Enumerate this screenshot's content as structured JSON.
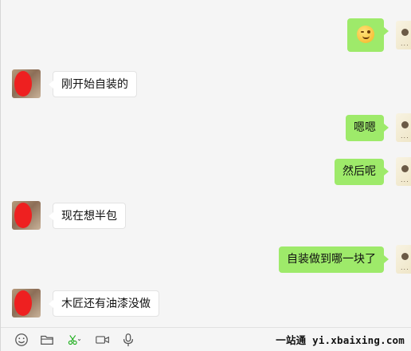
{
  "messages": [
    {
      "side": "right",
      "type": "emoji",
      "emoji": "wink-emoji"
    },
    {
      "side": "left",
      "text": "刚开始自装的"
    },
    {
      "side": "right",
      "text": "嗯嗯"
    },
    {
      "side": "right",
      "text": "然后呢"
    },
    {
      "side": "left",
      "text": "现在想半包"
    },
    {
      "side": "right",
      "text": "自装做到哪一块了"
    },
    {
      "side": "left",
      "text": "木匠还有油漆没做"
    }
  ],
  "toolbar": {
    "icons": [
      "emoji-icon",
      "folder-icon",
      "scissors-icon",
      "video-icon",
      "microphone-icon"
    ]
  },
  "watermark": "一站通 yi.xbaixing.com",
  "colors": {
    "self_bubble": "#9eea6a",
    "other_bubble": "#ffffff",
    "background": "#f5f5f5",
    "accent_green": "#1aad19"
  }
}
